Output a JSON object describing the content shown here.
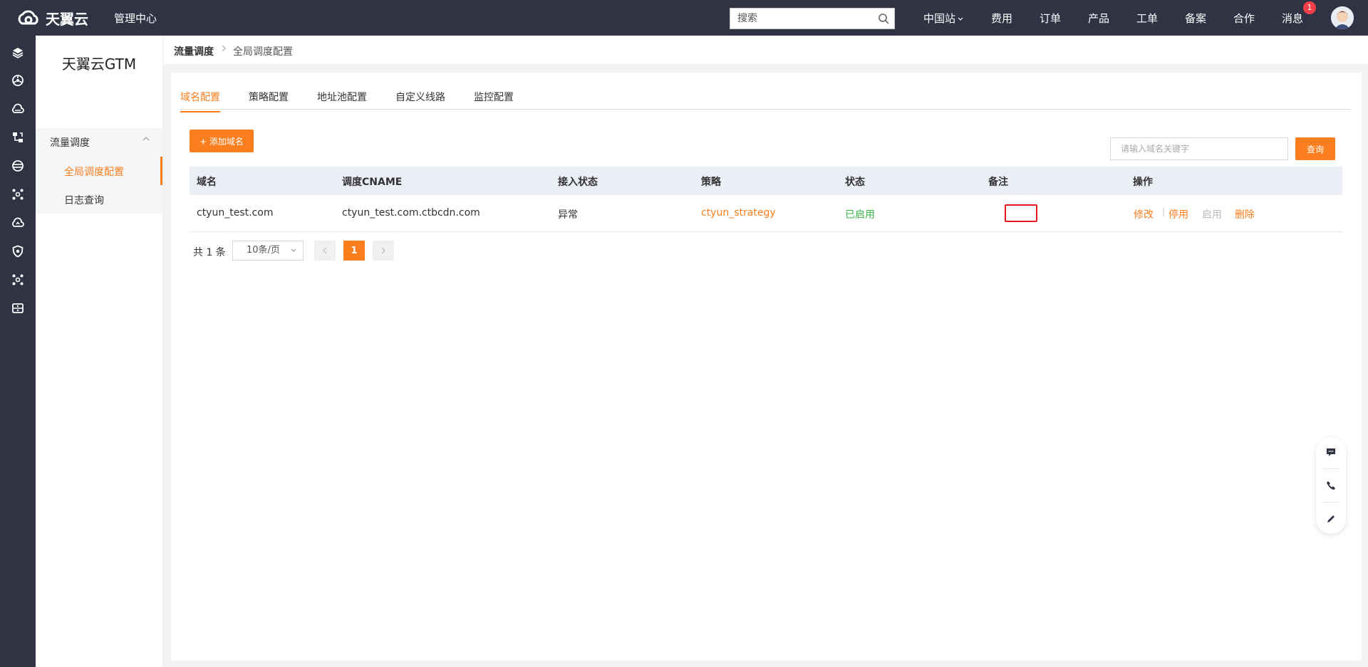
{
  "topbar": {
    "brand": "天翼云",
    "mgmt": "管理中心",
    "search_placeholder": "搜索",
    "nav": [
      "中国站",
      "费用",
      "订单",
      "产品",
      "工单",
      "备案",
      "合作",
      "消息"
    ],
    "message_badge": "1"
  },
  "rail_icons": [
    "layers-icon",
    "globe-icon",
    "cloud-icon",
    "network-icon",
    "database-icon",
    "hub-icon",
    "cloud-upload-icon",
    "shield-icon",
    "hub2-icon",
    "storage-icon"
  ],
  "sidebar": {
    "title": "天翼云GTM",
    "group": "流量调度",
    "items": [
      "全局调度配置",
      "日志查询"
    ]
  },
  "breadcrumb": {
    "parent": "流量调度",
    "current": "全局调度配置"
  },
  "tabs": [
    "域名配置",
    "策略配置",
    "地址池配置",
    "自定义线路",
    "监控配置"
  ],
  "toolbar": {
    "add_label": "+ 添加域名",
    "query_placeholder": "请输入域名关键字",
    "query_label": "查询"
  },
  "table": {
    "headers": [
      "域名",
      "调度CNAME",
      "接入状态",
      "策略",
      "状态",
      "备注",
      "操作"
    ],
    "rows": [
      {
        "domain": "ctyun_test.com",
        "cname": "ctyun_test.com.ctbcdn.com",
        "access": "异常",
        "strategy": "ctyun_strategy",
        "status": "已启用",
        "remark": "",
        "ops": [
          "修改",
          "停用",
          "启用",
          "删除"
        ]
      }
    ]
  },
  "pager": {
    "total": "共 1 条",
    "page_size": "10条/页",
    "current": "1"
  },
  "colors": {
    "accent": "#fa7d1e",
    "topbar": "#2f3344",
    "status_green": "#3ab54a",
    "highlight_red": "#e4151c"
  }
}
